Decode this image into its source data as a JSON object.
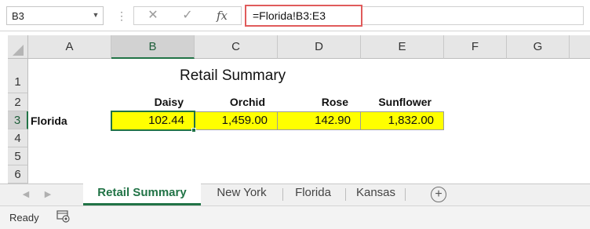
{
  "name_box": {
    "value": "B3"
  },
  "formula_bar": {
    "cancel_glyph": "✕",
    "enter_glyph": "✓",
    "function_glyph": "fx",
    "formula": "=Florida!B3:E3"
  },
  "columns": [
    "A",
    "B",
    "C",
    "D",
    "E",
    "F",
    "G"
  ],
  "rows": [
    "1",
    "2",
    "3",
    "4",
    "5",
    "6"
  ],
  "sheet": {
    "title": "Retail Summary",
    "headers": [
      "Daisy",
      "Orchid",
      "Rose",
      "Sunflower"
    ],
    "row_label": "Florida",
    "values": [
      "102.44",
      "1,459.00",
      "142.90",
      "1,832.00"
    ]
  },
  "tabs": [
    "Retail Summary",
    "New York",
    "Florida",
    "Kansas"
  ],
  "add_sheet_glyph": "+",
  "status": {
    "text": "Ready"
  },
  "colors": {
    "accent": "#217346",
    "highlight": "#ffff00",
    "callout": "#e05b5b"
  }
}
